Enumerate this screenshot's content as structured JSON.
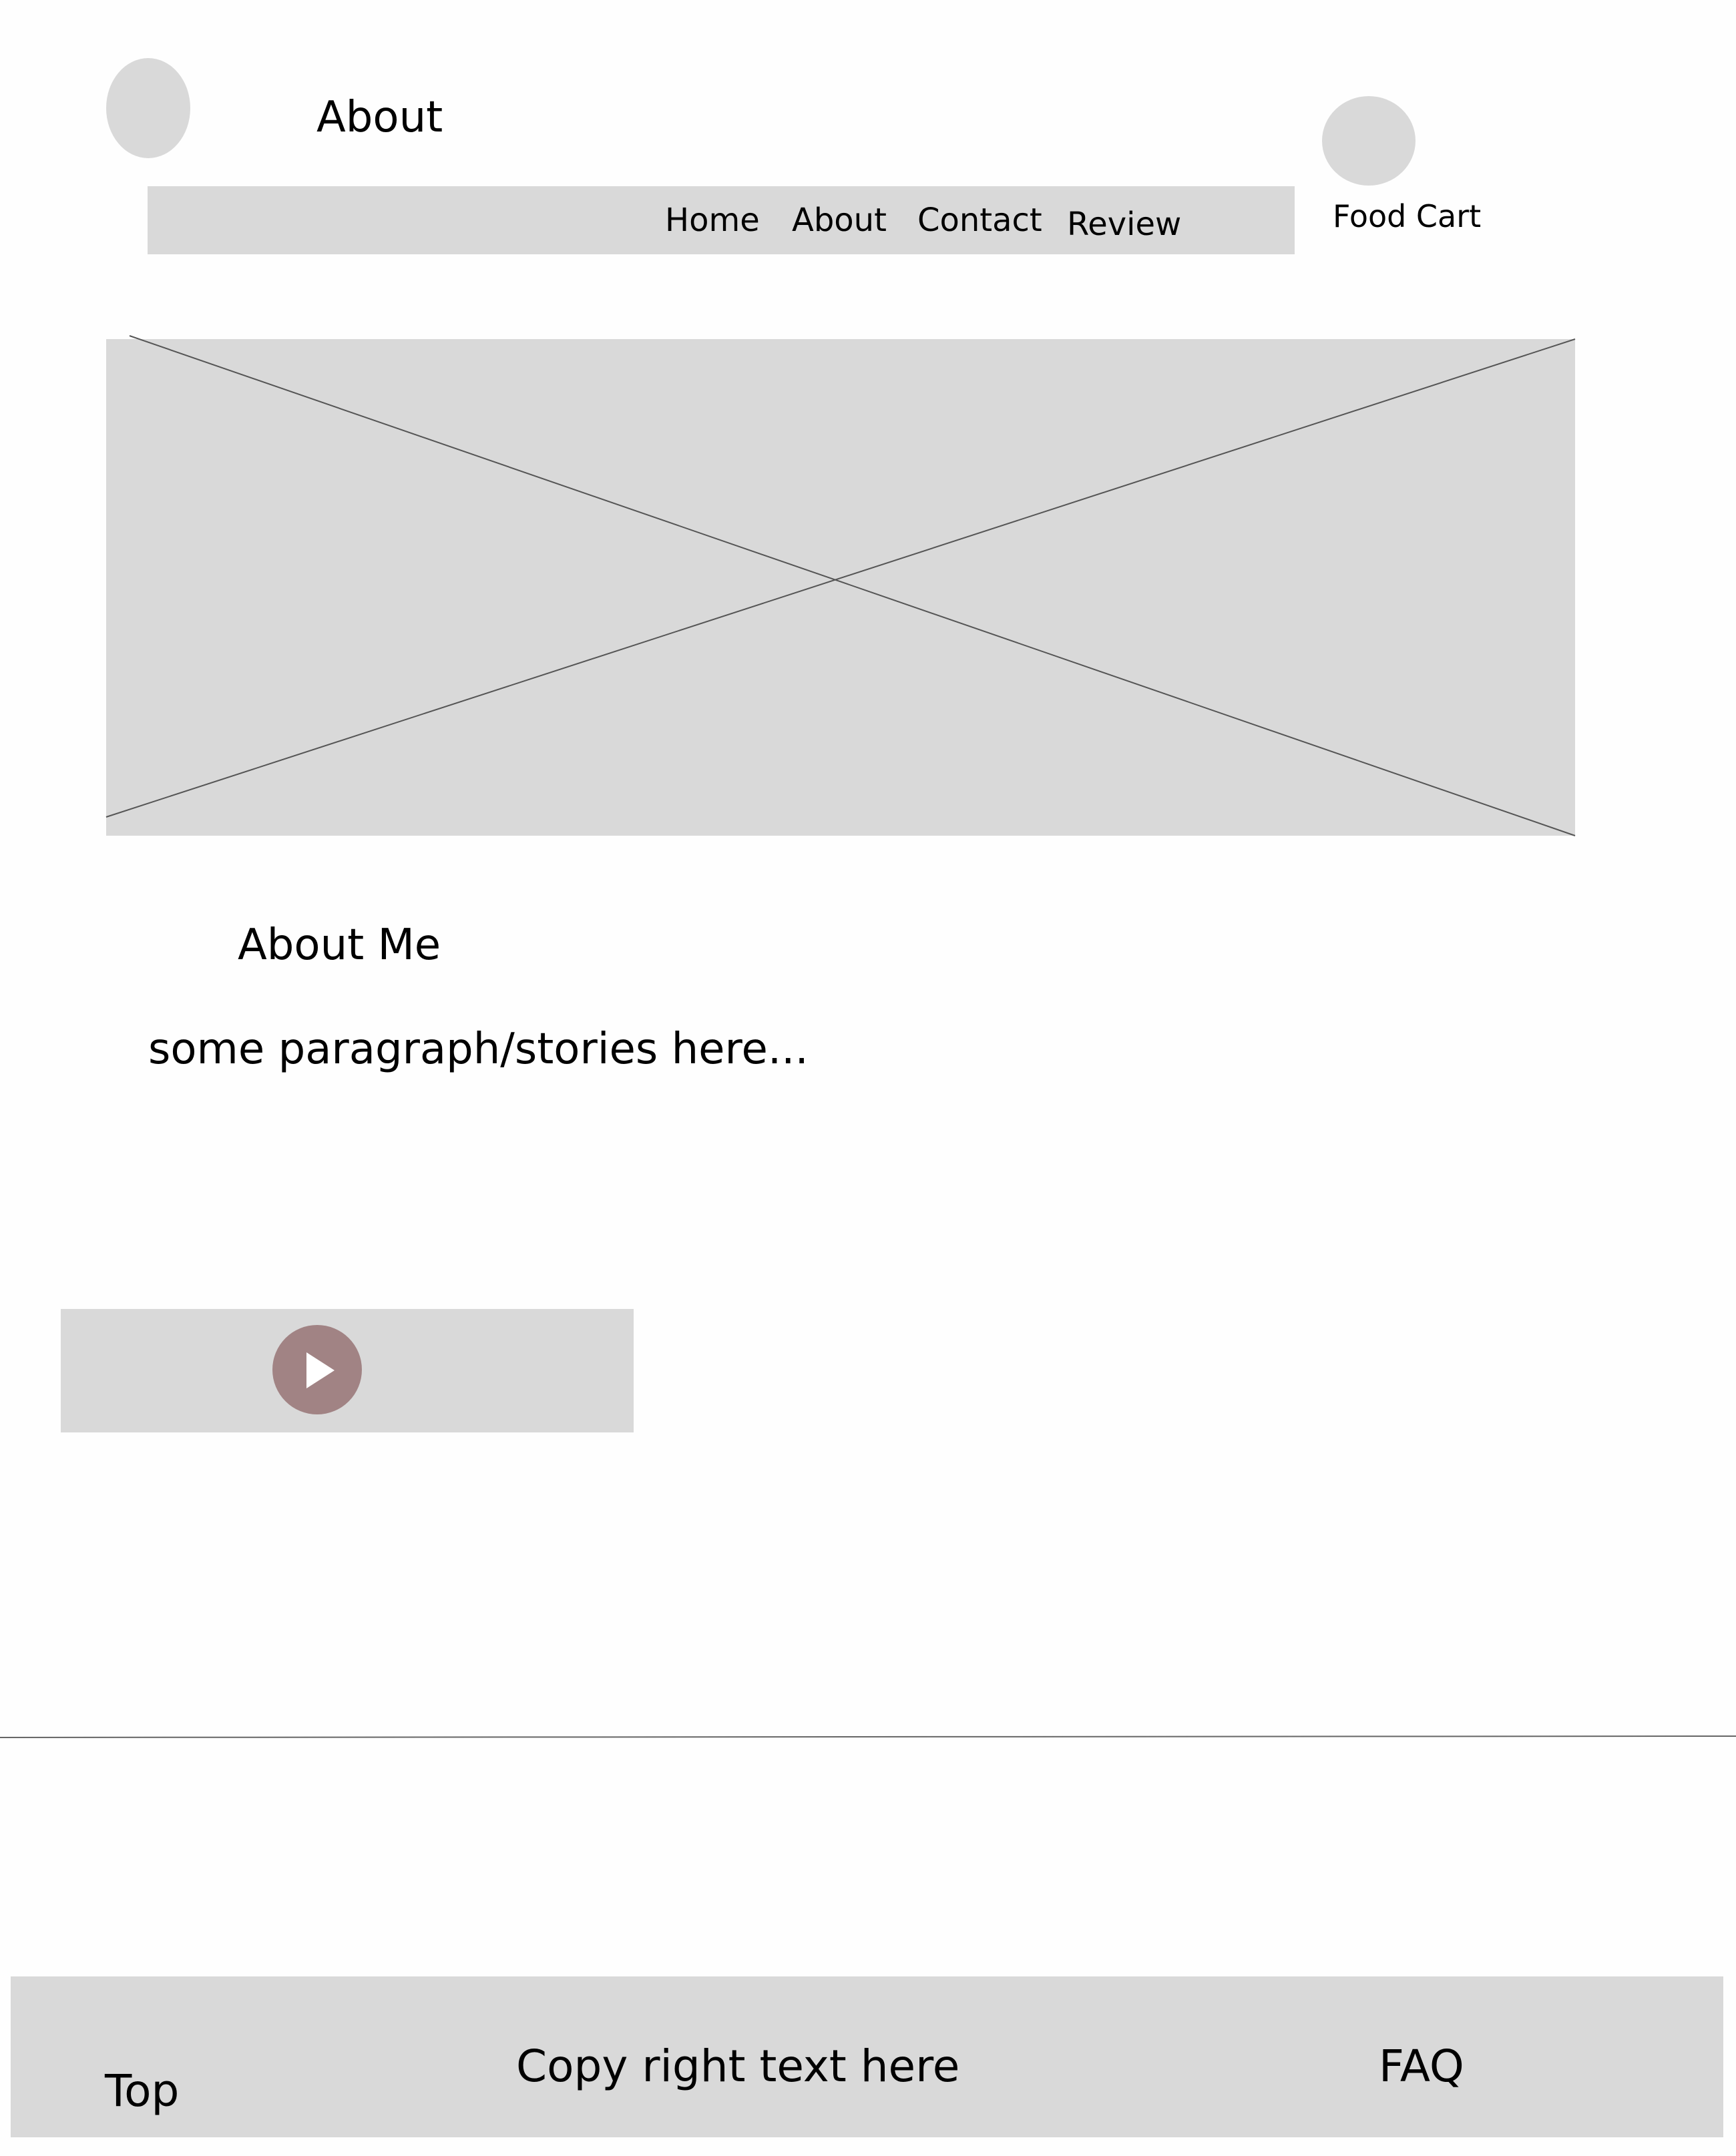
{
  "header": {
    "page_title": "About",
    "logo_icon": "logo-placeholder-icon"
  },
  "nav": {
    "items": [
      {
        "label": "Home"
      },
      {
        "label": "About"
      },
      {
        "label": "Contact"
      },
      {
        "label": "Review"
      }
    ]
  },
  "cart": {
    "label": "Food Cart",
    "icon": "cart-placeholder-icon"
  },
  "hero": {
    "image": "image-placeholder"
  },
  "about": {
    "heading": "About Me",
    "paragraph": "some paragraph/stories here..."
  },
  "video": {
    "icon": "play-icon"
  },
  "footer": {
    "top_link": "Top",
    "copyright": "Copy right text here",
    "faq_link": "FAQ"
  },
  "colors": {
    "placeholder_gray": "#d9d9d9",
    "play_button": "#a18384",
    "text": "#000000",
    "lines": "#555555"
  }
}
